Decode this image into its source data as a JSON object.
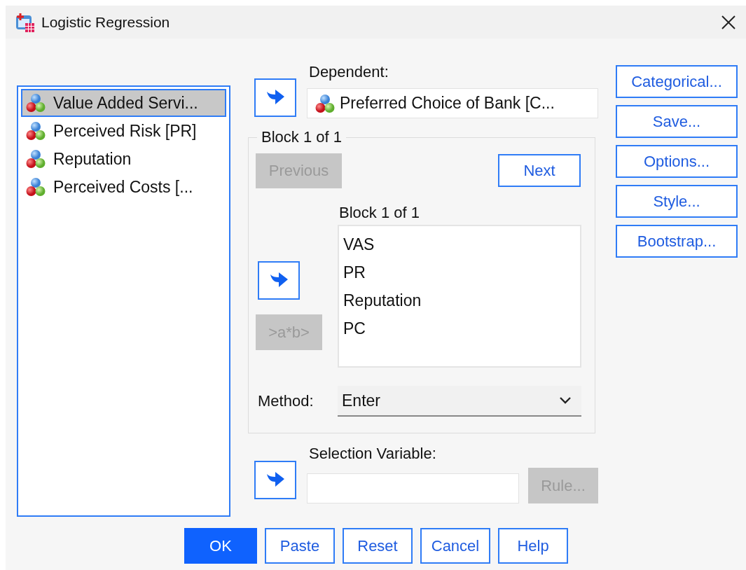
{
  "window": {
    "title": "Logistic Regression"
  },
  "variables": [
    {
      "label": "Value Added Servi...",
      "selected": true
    },
    {
      "label": "Perceived Risk [PR]",
      "selected": false
    },
    {
      "label": "Reputation",
      "selected": false
    },
    {
      "label": "Perceived Costs [...",
      "selected": false
    }
  ],
  "dependent": {
    "label": "Dependent:",
    "value": "Preferred Choice of Bank [C..."
  },
  "block_group": {
    "title": "Block 1 of 1",
    "nav_buttons": [
      {
        "label": "Previous",
        "disabled": true
      },
      {
        "label": "Next",
        "disabled": false
      }
    ],
    "list_label": "Block 1 of 1",
    "covariates": [
      "VAS",
      "PR",
      "Reputation",
      "PC"
    ],
    "interaction_button": {
      "label": ">a*b>",
      "disabled": true
    },
    "method": {
      "label": "Method:",
      "value": "Enter"
    }
  },
  "selection": {
    "label": "Selection Variable:",
    "rule_button": {
      "label": "Rule...",
      "disabled": true
    }
  },
  "side_buttons": [
    {
      "label": "Categorical..."
    },
    {
      "label": "Save..."
    },
    {
      "label": "Options..."
    },
    {
      "label": "Style..."
    },
    {
      "label": "Bootstrap..."
    }
  ],
  "bottom_buttons": [
    {
      "label": "OK",
      "default": true
    },
    {
      "label": "Paste",
      "default": false
    },
    {
      "label": "Reset",
      "default": false
    },
    {
      "label": "Cancel",
      "default": false
    },
    {
      "label": "Help",
      "default": false
    }
  ]
}
